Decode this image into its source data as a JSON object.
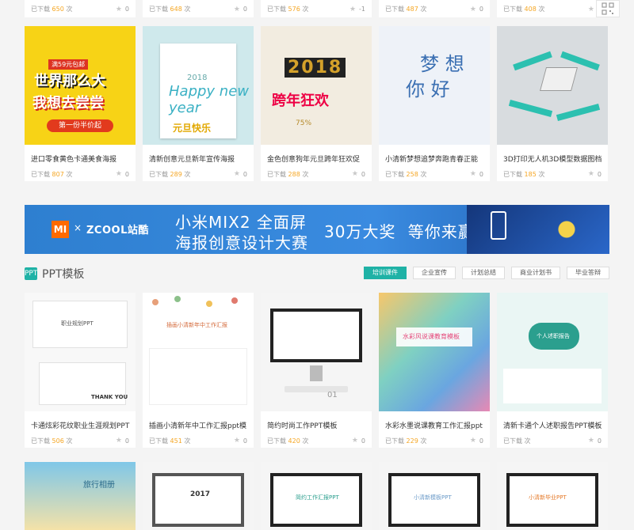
{
  "top_row": [
    {
      "downloads": "650",
      "likes": "0"
    },
    {
      "downloads": "648",
      "likes": "0"
    },
    {
      "downloads": "576",
      "likes": "-1"
    },
    {
      "downloads": "487",
      "likes": "0"
    },
    {
      "downloads": "408",
      "likes": "0"
    }
  ],
  "meta_prefix": "已下载",
  "meta_suffix": "次",
  "row1": [
    {
      "title": "进口零食黄色卡通美食海报",
      "downloads": "807",
      "likes": "0",
      "art": "yellow",
      "art_text": [
        "满59元包邮",
        "世界那么大",
        "我想去尝尝",
        "第一份半价起"
      ]
    },
    {
      "title": "清新创意元旦新年宣传海报",
      "downloads": "289",
      "likes": "0",
      "art": "mint",
      "art_text": [
        "2018",
        "Happy new year",
        "元旦快乐"
      ]
    },
    {
      "title": "金色创意狗年元旦跨年狂欢促",
      "downloads": "288",
      "likes": "0",
      "art": "gold",
      "art_text": [
        "2018",
        "跨年狂欢",
        "75%"
      ]
    },
    {
      "title": "小清新梦想追梦奔跑青春正能",
      "downloads": "258",
      "likes": "0",
      "art": "dream",
      "art_text": [
        "梦 想",
        "你 好"
      ]
    },
    {
      "title": "3D打印无人机3D模型数据图档",
      "downloads": "185",
      "likes": "0",
      "art": "drone",
      "art_text": []
    }
  ],
  "banner": {
    "brand_mi": "MI",
    "brand_x": "×",
    "brand_zcool": "ZCOOL站酷",
    "line1": "小米MIX2 全面屏",
    "line2": "海报创意设计大赛",
    "prize": "30万大奖  等你来赢"
  },
  "section": {
    "icon": "PPT",
    "title": "PPT模板",
    "tabs": [
      {
        "label": "培训课件",
        "active": true
      },
      {
        "label": "企业宣传",
        "active": false
      },
      {
        "label": "计划总结",
        "active": false
      },
      {
        "label": "商业计划书",
        "active": false
      },
      {
        "label": "毕业答辩",
        "active": false
      }
    ]
  },
  "row2": [
    {
      "title": "卡通炫彩花纹职业生涯规划PPT",
      "downloads": "506",
      "likes": "0",
      "art_text": [
        "职业规划PPT",
        "THANK YOU"
      ]
    },
    {
      "title": "插画小清新年中工作汇报ppt模",
      "downloads": "451",
      "likes": "0",
      "art_text": [
        "插画小清新年中工作汇报"
      ]
    },
    {
      "title": "简约时尚工作PPT模板",
      "downloads": "420",
      "likes": "0",
      "art_text": [
        "01"
      ]
    },
    {
      "title": "水彩水墨说课教育工作汇报ppt",
      "downloads": "229",
      "likes": "0",
      "art_text": [
        "水彩风说课教育模板"
      ]
    },
    {
      "title": "清新卡通个人述职报告PPT模板",
      "downloads": "",
      "likes": "0",
      "art_text": [
        "个人述职报告"
      ]
    }
  ],
  "row3": [
    {
      "art_text": [
        "旅行相册"
      ]
    },
    {
      "art_text": [
        "2017"
      ]
    },
    {
      "art_text": [
        "简约工作汇报PPT"
      ]
    },
    {
      "art_text": [
        "小清新模板PPT"
      ]
    },
    {
      "art_text": [
        "小清新毕业PPT"
      ]
    }
  ],
  "colors": {
    "accent": "#1fb2a6",
    "count": "#f5a623",
    "banner": "#2e7fd0"
  }
}
